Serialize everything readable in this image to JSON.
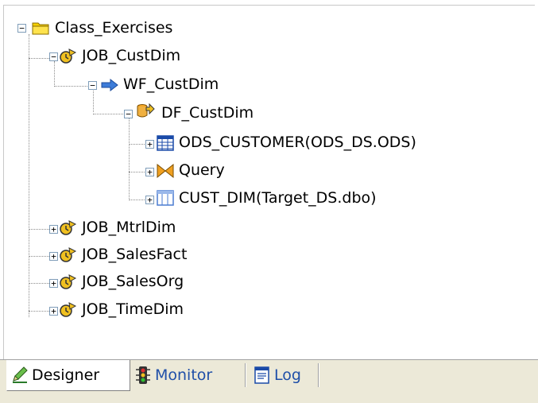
{
  "tree": {
    "root": "Class_Exercises",
    "job_custdim": "JOB_CustDim",
    "wf_custdim": "WF_CustDim",
    "df_custdim": "DF_CustDim",
    "ods_customer": "ODS_CUSTOMER(ODS_DS.ODS)",
    "query": "Query",
    "cust_dim": "CUST_DIM(Target_DS.dbo)",
    "job_mtrldim": "JOB_MtrlDim",
    "job_salesfact": "JOB_SalesFact",
    "job_salesorg": "JOB_SalesOrg",
    "job_timedim": "JOB_TimeDim",
    "expand_symbol": "+",
    "collapse_symbol": "−"
  },
  "tabs": {
    "designer": "Designer",
    "monitor": "Monitor",
    "log": "Log"
  },
  "colors": {
    "folder": "#f5d000",
    "job_icon": "#f0c020",
    "arrow_blue": "#3d7cd8",
    "table_blue": "#1a4aa8",
    "monitor_text": "#1f4fa8"
  }
}
